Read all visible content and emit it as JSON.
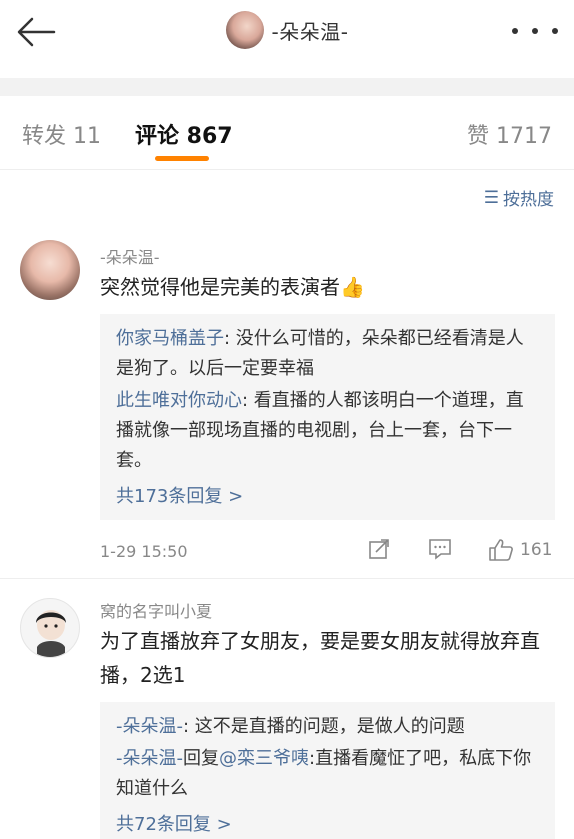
{
  "header": {
    "back_icon": "arrow-left-icon",
    "title": "-朵朵温-",
    "more_icon": "more-horizontal-icon"
  },
  "tabs": {
    "repost": "转发 11",
    "comments": "评论 867",
    "likes": "赞 1717",
    "active": "comments",
    "accent": "#ff8200"
  },
  "sort": {
    "icon": "sort-icon",
    "label": "按热度"
  },
  "comments": [
    {
      "username": "-朵朵温-",
      "text": "突然觉得他是完美的表演者👍",
      "replies": [
        {
          "who": "你家马桶盖子",
          "text": ": 没什么可惜的，朵朵都已经看清是人是狗了。以后一定要幸福"
        },
        {
          "who": "此生唯对你动心",
          "text": ": 看直播的人都该明白一个道理，直播就像一部现场直播的电视剧，台上一套，台下一套。"
        }
      ],
      "more": "共173条回复 >",
      "time": "1-29 15:50",
      "likes": "161"
    },
    {
      "username": "窝的名字叫小夏",
      "text": "为了直播放弃了女朋友，要是要女朋友就得放弃直播，2选1",
      "replies": [
        {
          "who": "-朵朵温-",
          "text": ": 这不是直播的问题，是做人的问题"
        },
        {
          "who": "-朵朵温-",
          "mid": "回复",
          "mention": "@栾三爷咦",
          "text": ":直播看魔怔了吧，私底下你知道什么"
        }
      ],
      "more": "共72条回复 >"
    }
  ],
  "colors": {
    "link": "#4e6f99",
    "reply_bg": "#f5f5f5"
  }
}
